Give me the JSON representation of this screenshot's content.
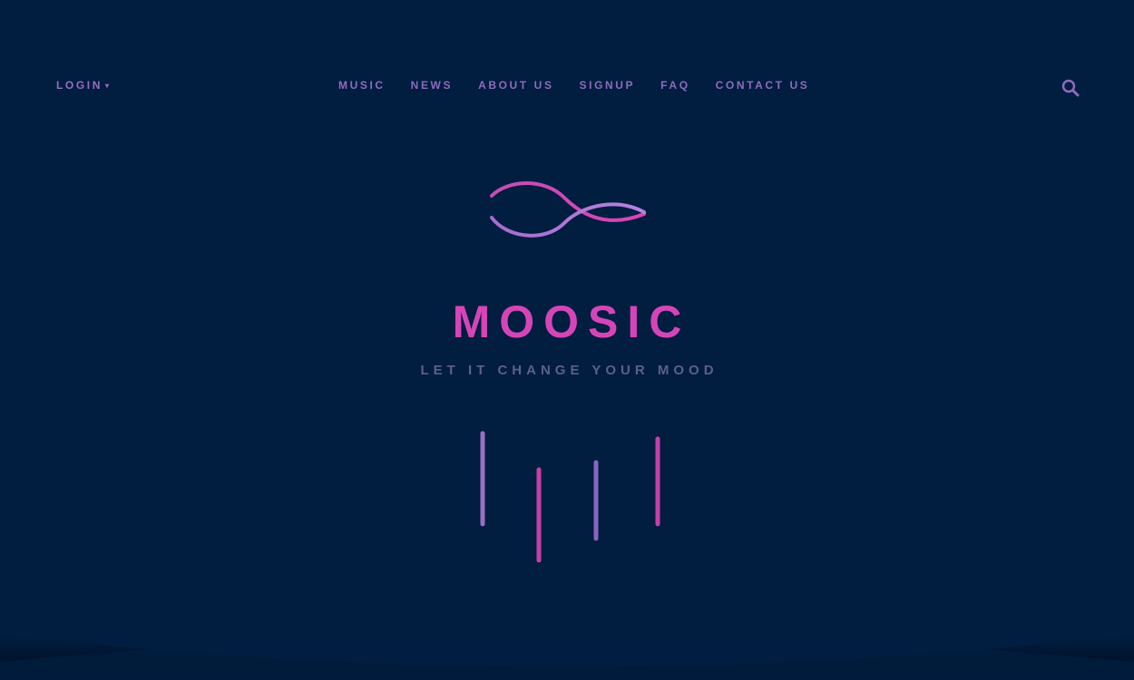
{
  "header": {
    "login_label": "LOGIN",
    "login_caret": "▾",
    "nav": [
      {
        "label": "MUSIC"
      },
      {
        "label": "NEWS"
      },
      {
        "label": "ABOUT US"
      },
      {
        "label": "SIGNUP"
      },
      {
        "label": "FAQ"
      },
      {
        "label": "CONTACT US"
      }
    ],
    "search_icon": "search-icon"
  },
  "hero": {
    "logo_icon": "infinity-wave-logo",
    "brand": "MOOSIC",
    "tagline": "LET IT CHANGE YOUR MOOD"
  },
  "colors": {
    "background": "#011d3f",
    "accent_pink": "#d545b8",
    "accent_purple": "#9a6fc0",
    "tagline": "#5c5f8f"
  }
}
